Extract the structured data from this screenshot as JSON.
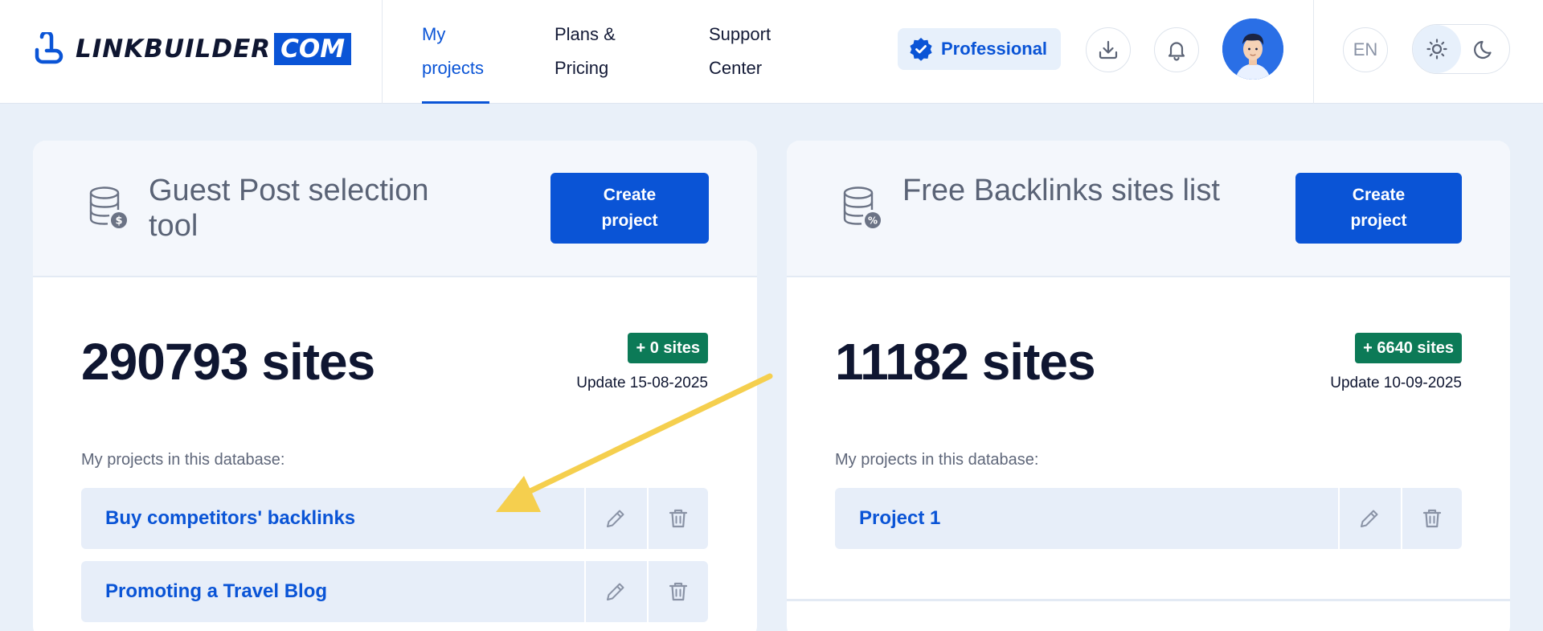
{
  "header": {
    "logo": {
      "word": "LINKBUILDER",
      "suffix": "COM"
    },
    "nav": [
      {
        "line1": "My",
        "line2": "projects",
        "active": true
      },
      {
        "line1": "Plans &",
        "line2": "Pricing",
        "active": false
      },
      {
        "line1": "Support",
        "line2": "Center",
        "active": false
      }
    ],
    "plan_label": "Professional",
    "language": "EN",
    "theme_selected": "light"
  },
  "cards": [
    {
      "title": "Guest Post selection tool",
      "icon": "database-dollar-icon",
      "create_line1": "Create",
      "create_line2": "project",
      "sites_count": "290793 sites",
      "delta": "+ 0 sites",
      "update": "Update 15-08-2025",
      "projects_label": "My projects in this database:",
      "projects": [
        {
          "name": "Buy competitors' backlinks"
        },
        {
          "name": "Promoting a Travel Blog"
        }
      ]
    },
    {
      "title": "Free Backlinks sites list",
      "icon": "database-percent-icon",
      "create_line1": "Create",
      "create_line2": "project",
      "sites_count": "11182 sites",
      "delta": "+ 6640 sites",
      "update": "Update 10-09-2025",
      "projects_label": "My projects in this database:",
      "projects": [
        {
          "name": "Project 1"
        }
      ]
    }
  ],
  "colors": {
    "accent": "#0a54d6",
    "delta_green": "#0c7a57",
    "page_bg": "#e9f0f9",
    "annotation_arrow": "#f5cf4e"
  }
}
